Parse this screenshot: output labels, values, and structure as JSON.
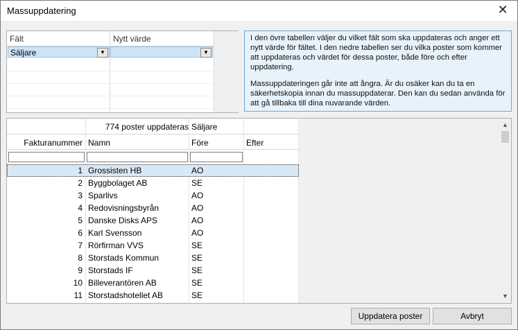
{
  "window": {
    "title": "Massuppdatering",
    "close_glyph": "✕"
  },
  "upper_grid": {
    "columns": [
      "Fält",
      "Nytt värde"
    ],
    "rows": [
      {
        "field": "Säljare",
        "value": ""
      }
    ]
  },
  "info": {
    "paragraph1": "I den övre tabellen väljer du vilket fält som ska uppdateras och anger ett nytt värde för fältet. I den nedre tabellen ser du vilka poster som kommer att uppdateras och värdet för dessa poster, både före och efter uppdatering.",
    "paragraph2": "Massuppdateringen går inte att ångra. Är du osäker kan du ta en säkerhetskopia innan du massuppdaterar. Den kan du sedan använda för att gå tillbaka till dina nuvarande värden."
  },
  "lower_grid": {
    "record_count": "774 poster uppdateras",
    "field_name": "Säljare",
    "columns": [
      "Fakturanummer",
      "Namn",
      "Före",
      "Efter"
    ],
    "rows": [
      {
        "nr": "1",
        "name": "Grossisten HB",
        "before": "AO",
        "after": ""
      },
      {
        "nr": "2",
        "name": "Byggbolaget AB",
        "before": "SE",
        "after": ""
      },
      {
        "nr": "3",
        "name": "Sparlivs",
        "before": "AO",
        "after": ""
      },
      {
        "nr": "4",
        "name": "Redovisningsbyrån",
        "before": "AO",
        "after": ""
      },
      {
        "nr": "5",
        "name": "Danske Disks APS",
        "before": "AO",
        "after": ""
      },
      {
        "nr": "6",
        "name": "Karl Svensson",
        "before": "AO",
        "after": ""
      },
      {
        "nr": "7",
        "name": "Rörfirman VVS",
        "before": "SE",
        "after": ""
      },
      {
        "nr": "8",
        "name": "Storstads Kommun",
        "before": "SE",
        "after": ""
      },
      {
        "nr": "9",
        "name": "Storstads IF",
        "before": "SE",
        "after": ""
      },
      {
        "nr": "10",
        "name": "Billeverantören AB",
        "before": "SE",
        "after": ""
      },
      {
        "nr": "11",
        "name": "Storstadshotellet AB",
        "before": "SE",
        "after": ""
      }
    ]
  },
  "buttons": {
    "update": "Uppdatera poster",
    "cancel": "Avbryt"
  },
  "colors": {
    "selection": "#cde4f7",
    "info_background": "#e7f2fb",
    "info_border": "#6fa7d6"
  },
  "icons": {
    "close": "close-icon",
    "dropdown": "chevron-down-icon",
    "scroll_up": "scroll-up-icon",
    "scroll_down": "scroll-down-icon"
  }
}
